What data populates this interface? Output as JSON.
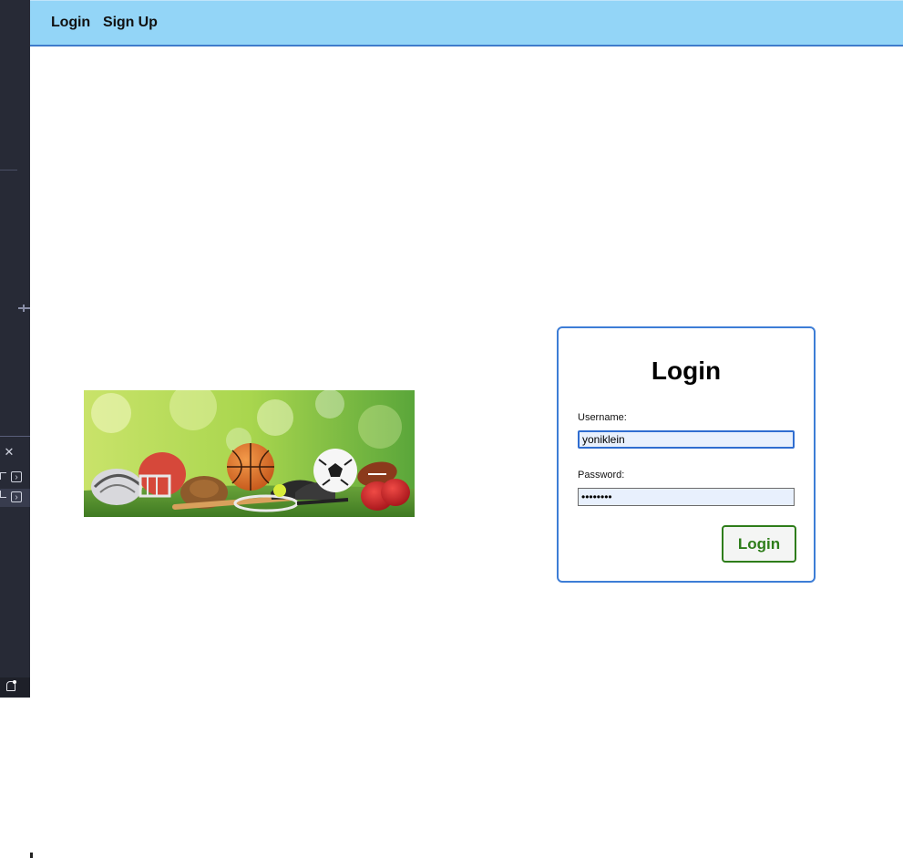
{
  "navbar": {
    "links": [
      "Login",
      "Sign Up"
    ]
  },
  "hero": {
    "image_icon": "sports-equipment-image"
  },
  "login_form": {
    "title": "Login",
    "username_label": "Username:",
    "username_value": "yoniklein",
    "password_label": "Password:",
    "password_value": "••••••••",
    "submit_label": "Login"
  },
  "ide_sidebar": {
    "icons": [
      "close-icon",
      "chevron-right-icon",
      "chevron-right-icon",
      "bell-icon"
    ]
  },
  "colors": {
    "navbar_bg": "#93d5f7",
    "navbar_border": "#3e7ccc",
    "card_border": "#3d7dd6",
    "button_accent": "#2e7d1a",
    "input_bg": "#e8f0fd",
    "ide_bg": "#272a36"
  }
}
